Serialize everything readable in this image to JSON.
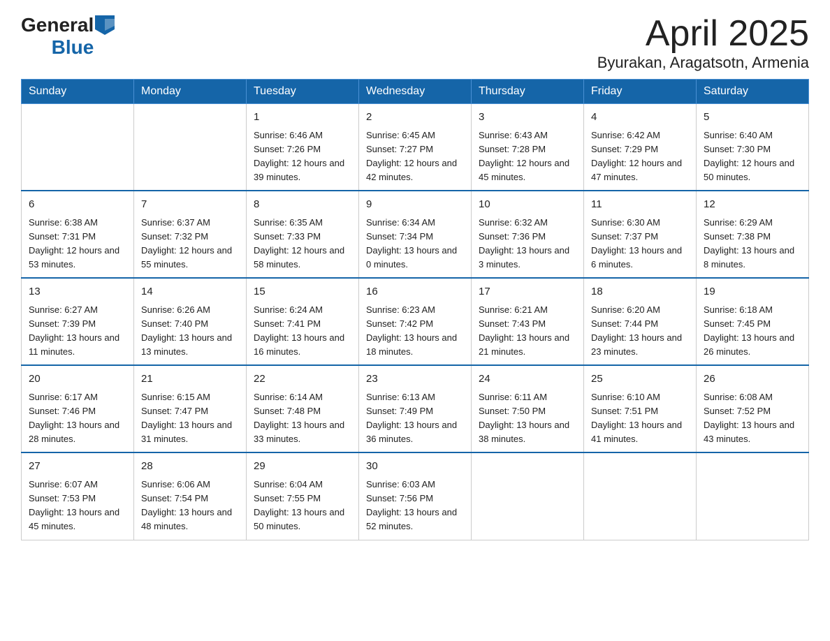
{
  "header": {
    "logo_general": "General",
    "logo_blue": "Blue",
    "month": "April 2025",
    "location": "Byurakan, Aragatsotn, Armenia"
  },
  "weekdays": [
    "Sunday",
    "Monday",
    "Tuesday",
    "Wednesday",
    "Thursday",
    "Friday",
    "Saturday"
  ],
  "weeks": [
    [
      {
        "day": "",
        "sunrise": "",
        "sunset": "",
        "daylight": ""
      },
      {
        "day": "",
        "sunrise": "",
        "sunset": "",
        "daylight": ""
      },
      {
        "day": "1",
        "sunrise": "Sunrise: 6:46 AM",
        "sunset": "Sunset: 7:26 PM",
        "daylight": "Daylight: 12 hours and 39 minutes."
      },
      {
        "day": "2",
        "sunrise": "Sunrise: 6:45 AM",
        "sunset": "Sunset: 7:27 PM",
        "daylight": "Daylight: 12 hours and 42 minutes."
      },
      {
        "day": "3",
        "sunrise": "Sunrise: 6:43 AM",
        "sunset": "Sunset: 7:28 PM",
        "daylight": "Daylight: 12 hours and 45 minutes."
      },
      {
        "day": "4",
        "sunrise": "Sunrise: 6:42 AM",
        "sunset": "Sunset: 7:29 PM",
        "daylight": "Daylight: 12 hours and 47 minutes."
      },
      {
        "day": "5",
        "sunrise": "Sunrise: 6:40 AM",
        "sunset": "Sunset: 7:30 PM",
        "daylight": "Daylight: 12 hours and 50 minutes."
      }
    ],
    [
      {
        "day": "6",
        "sunrise": "Sunrise: 6:38 AM",
        "sunset": "Sunset: 7:31 PM",
        "daylight": "Daylight: 12 hours and 53 minutes."
      },
      {
        "day": "7",
        "sunrise": "Sunrise: 6:37 AM",
        "sunset": "Sunset: 7:32 PM",
        "daylight": "Daylight: 12 hours and 55 minutes."
      },
      {
        "day": "8",
        "sunrise": "Sunrise: 6:35 AM",
        "sunset": "Sunset: 7:33 PM",
        "daylight": "Daylight: 12 hours and 58 minutes."
      },
      {
        "day": "9",
        "sunrise": "Sunrise: 6:34 AM",
        "sunset": "Sunset: 7:34 PM",
        "daylight": "Daylight: 13 hours and 0 minutes."
      },
      {
        "day": "10",
        "sunrise": "Sunrise: 6:32 AM",
        "sunset": "Sunset: 7:36 PM",
        "daylight": "Daylight: 13 hours and 3 minutes."
      },
      {
        "day": "11",
        "sunrise": "Sunrise: 6:30 AM",
        "sunset": "Sunset: 7:37 PM",
        "daylight": "Daylight: 13 hours and 6 minutes."
      },
      {
        "day": "12",
        "sunrise": "Sunrise: 6:29 AM",
        "sunset": "Sunset: 7:38 PM",
        "daylight": "Daylight: 13 hours and 8 minutes."
      }
    ],
    [
      {
        "day": "13",
        "sunrise": "Sunrise: 6:27 AM",
        "sunset": "Sunset: 7:39 PM",
        "daylight": "Daylight: 13 hours and 11 minutes."
      },
      {
        "day": "14",
        "sunrise": "Sunrise: 6:26 AM",
        "sunset": "Sunset: 7:40 PM",
        "daylight": "Daylight: 13 hours and 13 minutes."
      },
      {
        "day": "15",
        "sunrise": "Sunrise: 6:24 AM",
        "sunset": "Sunset: 7:41 PM",
        "daylight": "Daylight: 13 hours and 16 minutes."
      },
      {
        "day": "16",
        "sunrise": "Sunrise: 6:23 AM",
        "sunset": "Sunset: 7:42 PM",
        "daylight": "Daylight: 13 hours and 18 minutes."
      },
      {
        "day": "17",
        "sunrise": "Sunrise: 6:21 AM",
        "sunset": "Sunset: 7:43 PM",
        "daylight": "Daylight: 13 hours and 21 minutes."
      },
      {
        "day": "18",
        "sunrise": "Sunrise: 6:20 AM",
        "sunset": "Sunset: 7:44 PM",
        "daylight": "Daylight: 13 hours and 23 minutes."
      },
      {
        "day": "19",
        "sunrise": "Sunrise: 6:18 AM",
        "sunset": "Sunset: 7:45 PM",
        "daylight": "Daylight: 13 hours and 26 minutes."
      }
    ],
    [
      {
        "day": "20",
        "sunrise": "Sunrise: 6:17 AM",
        "sunset": "Sunset: 7:46 PM",
        "daylight": "Daylight: 13 hours and 28 minutes."
      },
      {
        "day": "21",
        "sunrise": "Sunrise: 6:15 AM",
        "sunset": "Sunset: 7:47 PM",
        "daylight": "Daylight: 13 hours and 31 minutes."
      },
      {
        "day": "22",
        "sunrise": "Sunrise: 6:14 AM",
        "sunset": "Sunset: 7:48 PM",
        "daylight": "Daylight: 13 hours and 33 minutes."
      },
      {
        "day": "23",
        "sunrise": "Sunrise: 6:13 AM",
        "sunset": "Sunset: 7:49 PM",
        "daylight": "Daylight: 13 hours and 36 minutes."
      },
      {
        "day": "24",
        "sunrise": "Sunrise: 6:11 AM",
        "sunset": "Sunset: 7:50 PM",
        "daylight": "Daylight: 13 hours and 38 minutes."
      },
      {
        "day": "25",
        "sunrise": "Sunrise: 6:10 AM",
        "sunset": "Sunset: 7:51 PM",
        "daylight": "Daylight: 13 hours and 41 minutes."
      },
      {
        "day": "26",
        "sunrise": "Sunrise: 6:08 AM",
        "sunset": "Sunset: 7:52 PM",
        "daylight": "Daylight: 13 hours and 43 minutes."
      }
    ],
    [
      {
        "day": "27",
        "sunrise": "Sunrise: 6:07 AM",
        "sunset": "Sunset: 7:53 PM",
        "daylight": "Daylight: 13 hours and 45 minutes."
      },
      {
        "day": "28",
        "sunrise": "Sunrise: 6:06 AM",
        "sunset": "Sunset: 7:54 PM",
        "daylight": "Daylight: 13 hours and 48 minutes."
      },
      {
        "day": "29",
        "sunrise": "Sunrise: 6:04 AM",
        "sunset": "Sunset: 7:55 PM",
        "daylight": "Daylight: 13 hours and 50 minutes."
      },
      {
        "day": "30",
        "sunrise": "Sunrise: 6:03 AM",
        "sunset": "Sunset: 7:56 PM",
        "daylight": "Daylight: 13 hours and 52 minutes."
      },
      {
        "day": "",
        "sunrise": "",
        "sunset": "",
        "daylight": ""
      },
      {
        "day": "",
        "sunrise": "",
        "sunset": "",
        "daylight": ""
      },
      {
        "day": "",
        "sunrise": "",
        "sunset": "",
        "daylight": ""
      }
    ]
  ]
}
